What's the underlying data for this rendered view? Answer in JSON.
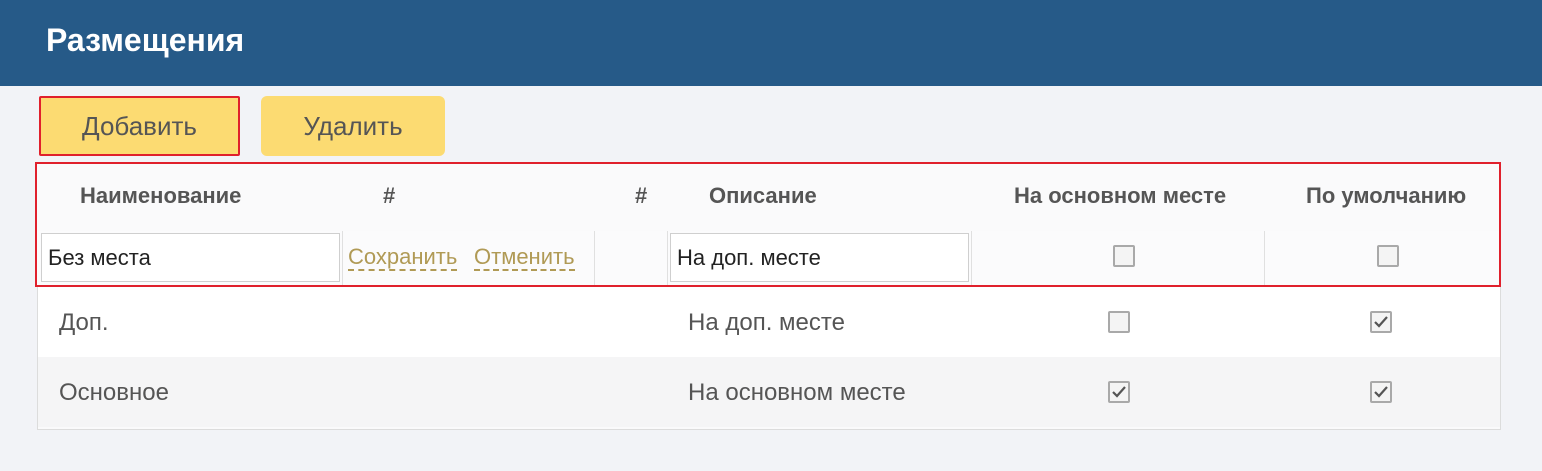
{
  "header": {
    "title": "Размещения"
  },
  "toolbar": {
    "add_label": "Добавить",
    "delete_label": "Удалить"
  },
  "table": {
    "columns": [
      "Наименование",
      "#",
      "#",
      "Описание",
      "На основном месте",
      "По умолчанию"
    ],
    "edit_row": {
      "name_value": "Без места",
      "save_label": "Сохранить",
      "cancel_label": "Отменить",
      "description_value": "На доп. месте",
      "main_place_checked": false,
      "default_checked": false
    },
    "rows": [
      {
        "name": "Доп.",
        "description": "На доп. месте",
        "main_place": false,
        "default": true
      },
      {
        "name": "Основное",
        "description": "На основном месте",
        "main_place": true,
        "default": true
      }
    ]
  },
  "colors": {
    "header_bg": "#265a88",
    "button_bg": "#fcdb72",
    "highlight": "#e0202c",
    "link": "#b09a55"
  }
}
